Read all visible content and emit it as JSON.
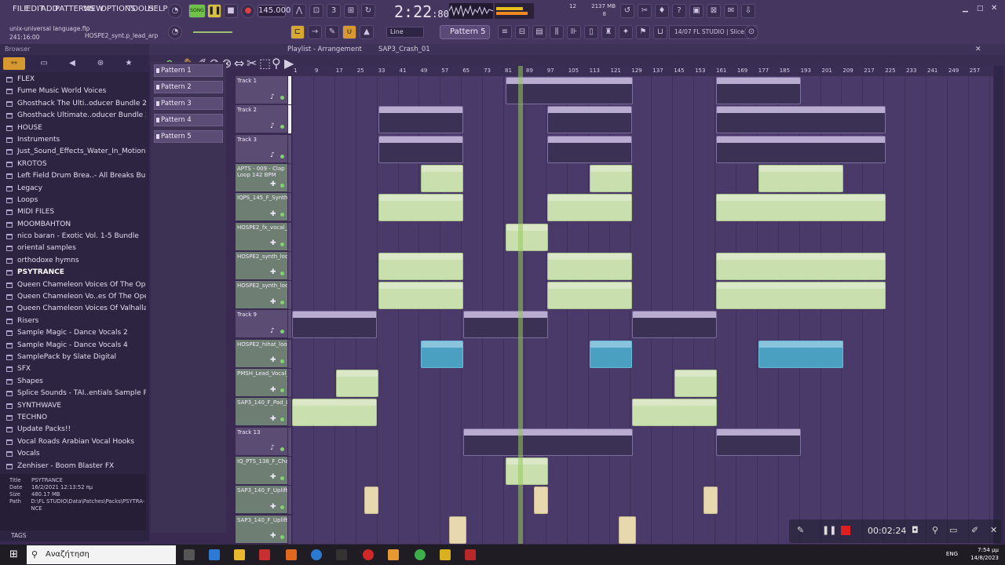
{
  "menu": [
    "FILE",
    "EDIT",
    "ADD",
    "PATTERNS",
    "VIEW",
    "OPTIONS",
    "TOOLS",
    "HELP"
  ],
  "transport": {
    "mode": "SONG",
    "tempo": "145.000",
    "time": "2:22",
    "time_sub": ":80",
    "time_label": "M:S:CS",
    "cpu": "12",
    "mem": "2137 MB",
    "voices": "8"
  },
  "hint": {
    "line1": "unix-universal language.flp",
    "line2": "241:16:00",
    "line3": "HOSPE2_synt.p_lead_arp"
  },
  "toolbar": {
    "snap": "Line",
    "pattern": "Pattern 5",
    "news": "14/07  FL STUDIO | Slicex"
  },
  "browser": {
    "title": "Browser",
    "items": [
      "FLEX",
      "Fume Music World Voices",
      "Ghosthack The Ulti..oducer Bundle 2020",
      "Ghosthack Ultimate..oducer Bundle 2022",
      "HOUSE",
      "Instruments",
      "Just_Sound_Effects_Water_In_Motion",
      "KROTOS",
      "Left Field Drum Brea..- All Breaks Bundle",
      "Legacy",
      "Loops",
      "MIDI FILES",
      "MOOMBAHTON",
      "nico baran - Exotic Vol. 1-5 Bundle",
      "oriental samples",
      "orthodoxe hymns",
      "PSYTRANCE",
      "Queen Chameleon Voices Of The Opera",
      "Queen Chameleon Vo..es Of The Opera II",
      "Queen Chameleon Voices Of Valhalla",
      "Risers",
      "Sample Magic - Dance Vocals 2",
      "Sample Magic - Dance Vocals 4",
      "SamplePack by Slate Digital",
      "SFX",
      "Shapes",
      "Splice Sounds - TAI..entials Sample Pack",
      "SYNTHWAVE",
      "TECHNO",
      "Update Packs!!",
      "Vocal Roads Arabian Vocal Hooks",
      "Vocals",
      "Zenhiser - Boom Blaster FX"
    ],
    "selected": "PSYTRANCE",
    "info": {
      "title_k": "Title",
      "title": "PSYTRANCE",
      "date_k": "Date",
      "date": "16/2/2021 12:13:52 πμ",
      "size_k": "Size",
      "size": "480.17 MB",
      "path_k": "Path",
      "path": "D:\\FL STUDIO\\Data\\Patches\\Packs\\PSYTRA-NCE"
    },
    "tags": "TAGS"
  },
  "patterns": [
    "Pattern 1",
    "Pattern 2",
    "Pattern 3",
    "Pattern 4",
    "Pattern 5"
  ],
  "playlist": {
    "title": "Playlist - Arrangement",
    "crumb": "SAP3_Crash_01"
  },
  "ruler": [
    "1",
    "9",
    "17",
    "25",
    "33",
    "41",
    "49",
    "57",
    "65",
    "73",
    "81",
    "89",
    "97",
    "105",
    "113",
    "121",
    "129",
    "137",
    "145",
    "153",
    "161",
    "169",
    "177",
    "185",
    "193",
    "201",
    "209",
    "217",
    "225",
    "233",
    "241",
    "249",
    "257"
  ],
  "tracks": [
    "Track 1",
    "Track 2",
    "Track 3",
    "APTS - 009 - Clap Loop 142 BPM",
    "IQPS_145_F_Synth_Loop_51",
    "HOSPE2_fx_vocal_loop_146_F_focus",
    "HOSPE2_synth_loop_138_F_buzzy_a..",
    "HOSPE2_synth_loop_138_F_champ_l..",
    "Track 9",
    "HOSPE2_hihat_loop_146_devil",
    "PMSH_Lead_Vocal_Loop_35_138BPM..",
    "SAP3_140_F_Pad_Loop_15",
    "Track 13",
    "IQ_PTS_138_F_Chant_Loop_03_(Wet)",
    "SAP3_140_F_Uplifter_06",
    "SAP3_140_F_Uplifter_08"
  ],
  "recorder": {
    "time": "00:02:24"
  },
  "taskbar": {
    "search": "Αναζήτηση",
    "lang": "ENG",
    "time": "7:54 μμ",
    "date": "14/8/2023"
  }
}
